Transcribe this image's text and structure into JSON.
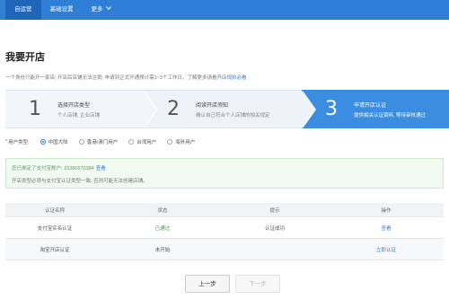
{
  "nav": {
    "items": [
      {
        "label": "自运营"
      },
      {
        "label": "基础设置"
      },
      {
        "label": "更多"
      }
    ]
  },
  "page": {
    "title": "我要开店",
    "notice": "一个身份只能开一家店; 开店后店铺无法注销; 申请到正式开通预计需1~3个工作日。了解更多请看",
    "notice_link": "开店规则必看"
  },
  "steps": [
    {
      "num": "1",
      "title": "选择开店类型",
      "desc": "个人店铺, 企业店铺"
    },
    {
      "num": "2",
      "title": "阅读开店须知",
      "desc": "确认自己符合个人店铺的相关规定"
    },
    {
      "num": "3",
      "title": "申请开店认证",
      "desc": "提供相关认证资料, 等待审核通过"
    }
  ],
  "region": {
    "label": "用户类型:",
    "options": [
      {
        "label": "中国大陆",
        "checked": true
      },
      {
        "label": "香港/澳门用户",
        "checked": false
      },
      {
        "label": "台湾用户",
        "checked": false
      },
      {
        "label": "海外用户",
        "checked": false
      }
    ]
  },
  "alipay": {
    "line1": "您已绑定了支付宝账户: 15386670384",
    "view_link": "查看",
    "line2": "开店类型必须与支付宝认证类型一致, 否则可能无法创建店铺。"
  },
  "table": {
    "headers": [
      "认证名称",
      "状态",
      "提示",
      "操作"
    ],
    "rows": [
      {
        "name": "支付宝实名认证",
        "status": "已通过",
        "tip": "认证成功",
        "action": "查看"
      },
      {
        "name": "淘宝开店认证",
        "status": "未开始",
        "tip": "",
        "action": "立即认证"
      }
    ]
  },
  "buttons": {
    "prev": "上一步",
    "next": "下一步"
  }
}
